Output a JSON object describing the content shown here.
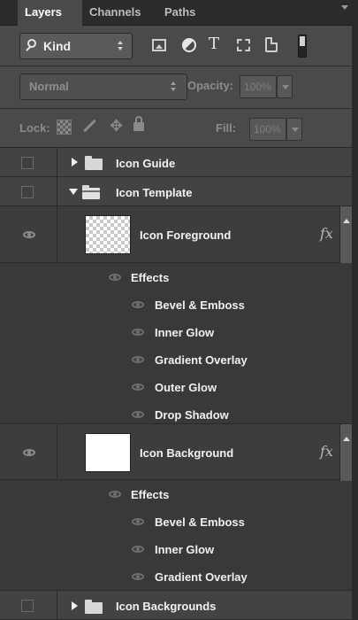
{
  "tabs": [
    {
      "label": "Layers",
      "active": true
    },
    {
      "label": "Channels",
      "active": false
    },
    {
      "label": "Paths",
      "active": false
    }
  ],
  "filter": {
    "kind_label": "Kind",
    "icons": [
      "pixel-layer-filter-icon",
      "adjustment-layer-filter-icon",
      "type-layer-filter-icon",
      "shape-layer-filter-icon",
      "smart-object-filter-icon",
      "filter-toggle-icon"
    ],
    "type_glyph": "T"
  },
  "blend": {
    "mode": "Normal",
    "opacity_label": "Opacity:",
    "opacity_value": "100%"
  },
  "lock": {
    "label": "Lock:",
    "fill_label": "Fill:",
    "fill_value": "100%"
  },
  "layers": [
    {
      "name": "Icon Guide",
      "type": "group",
      "expanded": false,
      "visible": false
    },
    {
      "name": "Icon Template",
      "type": "group",
      "expanded": true,
      "visible": false
    },
    {
      "name": "Icon Foreground",
      "type": "layer",
      "visible": true,
      "fx": "fx",
      "effects_label": "Effects",
      "effects": [
        "Bevel & Emboss",
        "Inner Glow",
        "Gradient Overlay",
        "Outer Glow",
        "Drop Shadow"
      ]
    },
    {
      "name": "Icon Background",
      "type": "layer",
      "visible": true,
      "fx": "fx",
      "effects_label": "Effects",
      "effects": [
        "Bevel & Emboss",
        "Inner Glow",
        "Gradient Overlay"
      ]
    },
    {
      "name": "Icon Backgrounds",
      "type": "group",
      "expanded": false,
      "visible": false
    }
  ],
  "colors": {
    "panel_bg": "#393939",
    "toolbar_bg": "#4a4a4a",
    "tab_active": "#4a4a4a",
    "text": "#f0f0f0",
    "dim_text": "#8c8c8c"
  }
}
